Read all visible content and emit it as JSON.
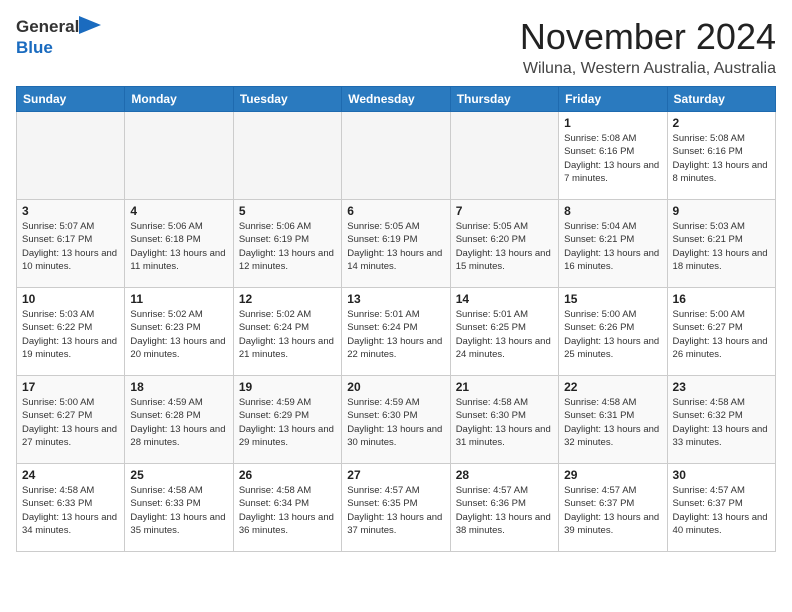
{
  "logo": {
    "general": "General",
    "blue": "Blue"
  },
  "title": "November 2024",
  "location": "Wiluna, Western Australia, Australia",
  "days_of_week": [
    "Sunday",
    "Monday",
    "Tuesday",
    "Wednesday",
    "Thursday",
    "Friday",
    "Saturday"
  ],
  "weeks": [
    [
      {
        "day": "",
        "info": ""
      },
      {
        "day": "",
        "info": ""
      },
      {
        "day": "",
        "info": ""
      },
      {
        "day": "",
        "info": ""
      },
      {
        "day": "",
        "info": ""
      },
      {
        "day": "1",
        "info": "Sunrise: 5:08 AM\nSunset: 6:16 PM\nDaylight: 13 hours and 7 minutes."
      },
      {
        "day": "2",
        "info": "Sunrise: 5:08 AM\nSunset: 6:16 PM\nDaylight: 13 hours and 8 minutes."
      }
    ],
    [
      {
        "day": "3",
        "info": "Sunrise: 5:07 AM\nSunset: 6:17 PM\nDaylight: 13 hours and 10 minutes."
      },
      {
        "day": "4",
        "info": "Sunrise: 5:06 AM\nSunset: 6:18 PM\nDaylight: 13 hours and 11 minutes."
      },
      {
        "day": "5",
        "info": "Sunrise: 5:06 AM\nSunset: 6:19 PM\nDaylight: 13 hours and 12 minutes."
      },
      {
        "day": "6",
        "info": "Sunrise: 5:05 AM\nSunset: 6:19 PM\nDaylight: 13 hours and 14 minutes."
      },
      {
        "day": "7",
        "info": "Sunrise: 5:05 AM\nSunset: 6:20 PM\nDaylight: 13 hours and 15 minutes."
      },
      {
        "day": "8",
        "info": "Sunrise: 5:04 AM\nSunset: 6:21 PM\nDaylight: 13 hours and 16 minutes."
      },
      {
        "day": "9",
        "info": "Sunrise: 5:03 AM\nSunset: 6:21 PM\nDaylight: 13 hours and 18 minutes."
      }
    ],
    [
      {
        "day": "10",
        "info": "Sunrise: 5:03 AM\nSunset: 6:22 PM\nDaylight: 13 hours and 19 minutes."
      },
      {
        "day": "11",
        "info": "Sunrise: 5:02 AM\nSunset: 6:23 PM\nDaylight: 13 hours and 20 minutes."
      },
      {
        "day": "12",
        "info": "Sunrise: 5:02 AM\nSunset: 6:24 PM\nDaylight: 13 hours and 21 minutes."
      },
      {
        "day": "13",
        "info": "Sunrise: 5:01 AM\nSunset: 6:24 PM\nDaylight: 13 hours and 22 minutes."
      },
      {
        "day": "14",
        "info": "Sunrise: 5:01 AM\nSunset: 6:25 PM\nDaylight: 13 hours and 24 minutes."
      },
      {
        "day": "15",
        "info": "Sunrise: 5:00 AM\nSunset: 6:26 PM\nDaylight: 13 hours and 25 minutes."
      },
      {
        "day": "16",
        "info": "Sunrise: 5:00 AM\nSunset: 6:27 PM\nDaylight: 13 hours and 26 minutes."
      }
    ],
    [
      {
        "day": "17",
        "info": "Sunrise: 5:00 AM\nSunset: 6:27 PM\nDaylight: 13 hours and 27 minutes."
      },
      {
        "day": "18",
        "info": "Sunrise: 4:59 AM\nSunset: 6:28 PM\nDaylight: 13 hours and 28 minutes."
      },
      {
        "day": "19",
        "info": "Sunrise: 4:59 AM\nSunset: 6:29 PM\nDaylight: 13 hours and 29 minutes."
      },
      {
        "day": "20",
        "info": "Sunrise: 4:59 AM\nSunset: 6:30 PM\nDaylight: 13 hours and 30 minutes."
      },
      {
        "day": "21",
        "info": "Sunrise: 4:58 AM\nSunset: 6:30 PM\nDaylight: 13 hours and 31 minutes."
      },
      {
        "day": "22",
        "info": "Sunrise: 4:58 AM\nSunset: 6:31 PM\nDaylight: 13 hours and 32 minutes."
      },
      {
        "day": "23",
        "info": "Sunrise: 4:58 AM\nSunset: 6:32 PM\nDaylight: 13 hours and 33 minutes."
      }
    ],
    [
      {
        "day": "24",
        "info": "Sunrise: 4:58 AM\nSunset: 6:33 PM\nDaylight: 13 hours and 34 minutes."
      },
      {
        "day": "25",
        "info": "Sunrise: 4:58 AM\nSunset: 6:33 PM\nDaylight: 13 hours and 35 minutes."
      },
      {
        "day": "26",
        "info": "Sunrise: 4:58 AM\nSunset: 6:34 PM\nDaylight: 13 hours and 36 minutes."
      },
      {
        "day": "27",
        "info": "Sunrise: 4:57 AM\nSunset: 6:35 PM\nDaylight: 13 hours and 37 minutes."
      },
      {
        "day": "28",
        "info": "Sunrise: 4:57 AM\nSunset: 6:36 PM\nDaylight: 13 hours and 38 minutes."
      },
      {
        "day": "29",
        "info": "Sunrise: 4:57 AM\nSunset: 6:37 PM\nDaylight: 13 hours and 39 minutes."
      },
      {
        "day": "30",
        "info": "Sunrise: 4:57 AM\nSunset: 6:37 PM\nDaylight: 13 hours and 40 minutes."
      }
    ]
  ]
}
